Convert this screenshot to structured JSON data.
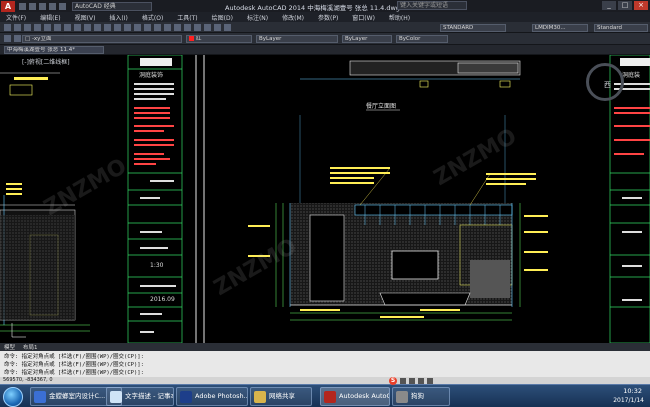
{
  "window": {
    "title": "Autodesk AutoCAD 2014    中海梅溪湖壹号 张总 11.4.dwg",
    "workspace": "AutoCAD 经典",
    "search_placeholder": "键入关键字或短语"
  },
  "menu": [
    "文件(F)",
    "编辑(E)",
    "视图(V)",
    "插入(I)",
    "格式(O)",
    "工具(T)",
    "绘图(D)",
    "标注(N)",
    "修改(M)",
    "参数(P)",
    "窗口(W)",
    "帮助(H)"
  ],
  "toolbar": {
    "doc_tab": "中海梅溪湖壹号 张总 11.4*",
    "view_label": "[-]俯视[二维线框]",
    "color": "红",
    "linetype": "ByLayer",
    "lineweight": "ByLayer",
    "plotstyle": "ByColor",
    "textstyle": "STANDARD",
    "dimstyle": "LMDIM30...",
    "tablestyle": "Standard",
    "layer_combo": "□ -xy立面"
  },
  "viewcube": {
    "label": "西"
  },
  "layout_tabs": [
    "模型",
    "布局1"
  ],
  "command": {
    "line1": "命令: 指定对角点或 [栏选(F)/圈围(WP)/圈交(CP)]:",
    "line2": "命令: 指定对角点或 [栏选(F)/圈围(WP)/圈交(CP)]:",
    "line3": "命令: 指定对角点或 [栏选(F)/圈围(WP)/圈交(CP)]:"
  },
  "status": {
    "coords": "569570, -834367, 0"
  },
  "taskbar": {
    "tasks": [
      {
        "label": "金螳螂室内设计C...",
        "color": "#3b6fd4"
      },
      {
        "label": "文字描述 - 记事本",
        "color": "#cfe3f6"
      },
      {
        "label": "Adobe Photosh...",
        "color": "#1d3e8a"
      },
      {
        "label": "网络共享",
        "color": "#d8b44c"
      },
      {
        "label": "Autodesk AutoC...",
        "color": "#b3261e"
      },
      {
        "label": "狗狗",
        "color": "#8a8a8a"
      }
    ],
    "time": "10:32",
    "date": "2017/1/14"
  },
  "title_block": {
    "left_brand": "洞庭装饰",
    "scale": "1:30",
    "date": "2016.09",
    "right_brand": "洞庭装"
  },
  "elevation": {
    "title": "餐厅立面图"
  }
}
